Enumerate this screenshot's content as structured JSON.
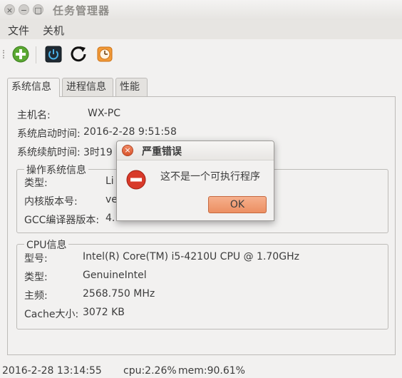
{
  "window": {
    "title": "任务管理器",
    "close_glyph": "×",
    "minimize_glyph": "−",
    "maximize_glyph": "□"
  },
  "menu": {
    "items": [
      "文件",
      "关机"
    ]
  },
  "toolbar": {
    "icons": [
      "add-icon",
      "power-icon",
      "refresh-icon",
      "clock-icon"
    ]
  },
  "tabs": [
    "系统信息",
    "进程信息",
    "性能"
  ],
  "sysinfo": {
    "hostname_label": "主机名:",
    "hostname": "WX-PC",
    "boot_label": "系统启动时间:",
    "boot_time": "2016-2-28 9:51:58",
    "uptime_label": "系统续航时间:",
    "uptime": "3时19",
    "os": {
      "title": "操作系统信息",
      "type_label": "类型:",
      "type": "Li",
      "kernel_label": "内核版本号:",
      "kernel": "ve",
      "gcc_label": "GCC编译器版本:",
      "gcc": "4."
    },
    "cpu": {
      "title": "CPU信息",
      "model_label": "型号:",
      "model": "Intel(R) Core(TM) i5-4210U CPU @ 1.70GHz",
      "type_label": "类型:",
      "type": "GenuineIntel",
      "freq_label": "主频:",
      "freq": "2568.750 MHz",
      "cache_label": "Cache大小:",
      "cache": "3072 KB"
    }
  },
  "status": {
    "time": "2016-2-28 13:14:55",
    "cpu": "cpu:2.26%",
    "mem": "mem:90.61%"
  },
  "dialog": {
    "title": "严重错误",
    "message": "这不是一个可执行程序",
    "ok_label": "OK",
    "close_glyph": "×"
  }
}
